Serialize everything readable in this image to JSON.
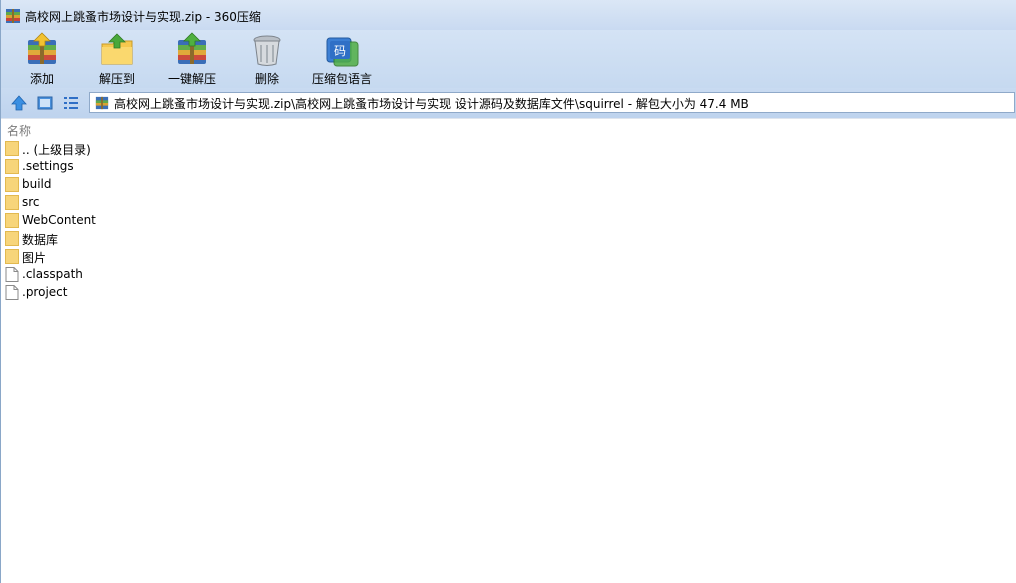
{
  "window": {
    "title": "高校网上跳蚤市场设计与实现.zip - 360压缩"
  },
  "toolbar": {
    "buttons": [
      {
        "label": "添加",
        "icon": "add-archive-icon"
      },
      {
        "label": "解压到",
        "icon": "extract-to-icon"
      },
      {
        "label": "一键解压",
        "icon": "one-click-extract-icon"
      },
      {
        "label": "删除",
        "icon": "trash-icon"
      },
      {
        "label": "压缩包语言",
        "icon": "encoding-icon"
      }
    ]
  },
  "nav": {
    "icons": [
      "up-arrow-icon",
      "large-icon-view-icon",
      "list-view-icon"
    ],
    "address": "高校网上跳蚤市场设计与实现.zip\\高校网上跳蚤市场设计与实现 设计源码及数据库文件\\squirrel - 解包大小为 47.4 MB"
  },
  "list": {
    "column_name": "名称",
    "items": [
      {
        "name": ".. (上级目录)",
        "type": "folder"
      },
      {
        "name": ".settings",
        "type": "folder"
      },
      {
        "name": "build",
        "type": "folder"
      },
      {
        "name": "src",
        "type": "folder"
      },
      {
        "name": "WebContent",
        "type": "folder"
      },
      {
        "name": "数据库",
        "type": "folder"
      },
      {
        "name": "图片",
        "type": "folder"
      },
      {
        "name": ".classpath",
        "type": "file"
      },
      {
        "name": ".project",
        "type": "file"
      }
    ]
  },
  "colors": {
    "toolbar_bg": "#c9daf1",
    "folder": "#f7d57a",
    "nav_blue": "#2f8be0"
  }
}
